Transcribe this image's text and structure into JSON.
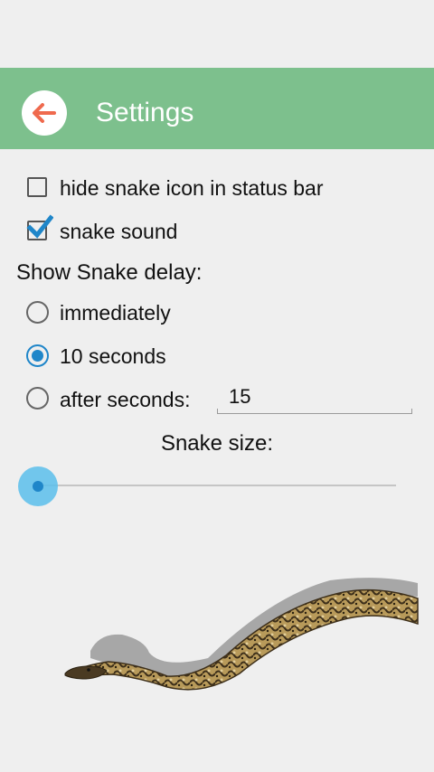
{
  "app_bar": {
    "title": "Settings",
    "back_icon": "arrow-left-icon",
    "bg_color": "#7dc08d",
    "back_arrow_color": "#ef6a4e"
  },
  "options": {
    "hide_icon": {
      "label": "hide snake icon in status bar",
      "checked": false
    },
    "snake_sound": {
      "label": "snake sound",
      "checked": true
    }
  },
  "delay": {
    "section_label": "Show Snake delay:",
    "choices": [
      {
        "label": "immediately",
        "selected": false
      },
      {
        "label": "10 seconds",
        "selected": true
      },
      {
        "label": "after seconds:",
        "selected": false
      }
    ],
    "after_seconds_value": "15"
  },
  "size": {
    "label": "Snake size:",
    "slider_level": 0.0
  },
  "accent_color": "#1f86c9",
  "check_color": "#1f86c9"
}
